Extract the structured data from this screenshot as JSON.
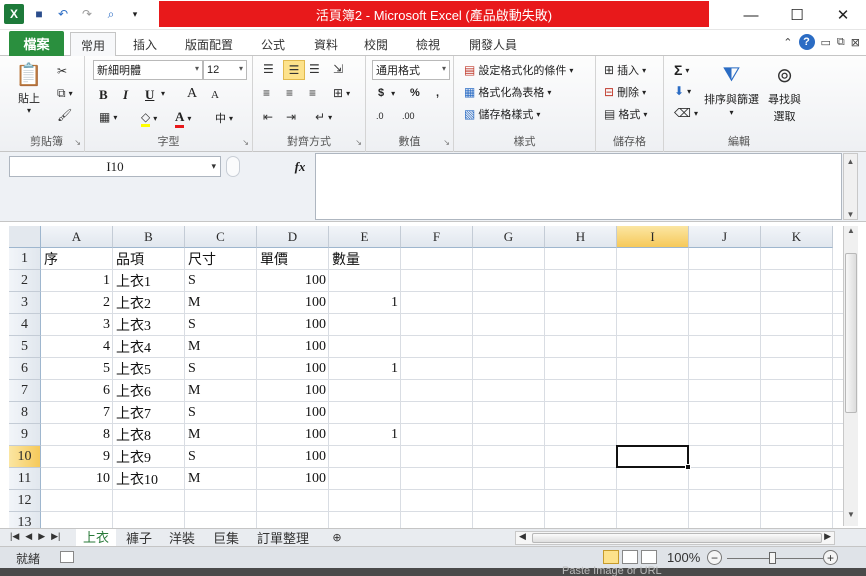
{
  "window": {
    "title": "活頁簿2 - Microsoft Excel (產品啟動失敗)",
    "minimize": "—",
    "maximize": "☐",
    "close": "✕"
  },
  "qat": {
    "logo": "X",
    "save_icon": "💾",
    "undo_icon": "↶",
    "redo_icon": "↷",
    "preview_icon": "🔍"
  },
  "tabs": [
    {
      "label": "檔案"
    },
    {
      "label": "常用"
    },
    {
      "label": "插入"
    },
    {
      "label": "版面配置"
    },
    {
      "label": "公式"
    },
    {
      "label": "資料"
    },
    {
      "label": "校閱"
    },
    {
      "label": "檢視"
    },
    {
      "label": "開發人員"
    }
  ],
  "help_label": "?",
  "ribbon": {
    "clipboard": {
      "label": "剪貼簿",
      "paste": "貼上"
    },
    "font": {
      "label": "字型",
      "font_name": "新細明體",
      "font_size": "12",
      "bold": "B",
      "italic": "I",
      "underline": "U",
      "grow": "A",
      "shrink": "A",
      "font_color_glyph": "A",
      "phonetic": "中"
    },
    "alignment": {
      "label": "對齊方式"
    },
    "number": {
      "label": "數值",
      "format": "通用格式",
      "currency": "$",
      "percent": "%",
      "comma": ",",
      "inc_decimal": ".0",
      "dec_decimal": ".00"
    },
    "styles": {
      "label": "樣式",
      "conditional": "設定格式化的條件",
      "as_table": "格式化為表格",
      "cell_styles": "儲存格樣式"
    },
    "cells": {
      "label": "儲存格",
      "insert": "插入",
      "delete": "刪除",
      "format": "格式"
    },
    "editing": {
      "label": "編輯",
      "sum": "Σ",
      "sort_filter": "排序與篩選",
      "find_select_1": "尋找與",
      "find_select_2": "選取"
    }
  },
  "formula_bar": {
    "name_box": "I10",
    "fx": "fx",
    "formula": ""
  },
  "columns": [
    "A",
    "B",
    "C",
    "D",
    "E",
    "F",
    "G",
    "H",
    "I",
    "J",
    "K"
  ],
  "active_column": "I",
  "row_numbers": [
    "1",
    "2",
    "3",
    "4",
    "5",
    "6",
    "7",
    "8",
    "9",
    "10",
    "11",
    "12",
    "13"
  ],
  "active_row": "10",
  "headers": {
    "A": "序",
    "B": "品項",
    "C": "尺寸",
    "D": "單價",
    "E": "數量"
  },
  "rows": [
    {
      "A": "1",
      "B": "上衣1",
      "C": "S",
      "D": "100",
      "E": ""
    },
    {
      "A": "2",
      "B": "上衣2",
      "C": "M",
      "D": "100",
      "E": "1"
    },
    {
      "A": "3",
      "B": "上衣3",
      "C": "S",
      "D": "100",
      "E": ""
    },
    {
      "A": "4",
      "B": "上衣4",
      "C": "M",
      "D": "100",
      "E": ""
    },
    {
      "A": "5",
      "B": "上衣5",
      "C": "S",
      "D": "100",
      "E": "1"
    },
    {
      "A": "6",
      "B": "上衣6",
      "C": "M",
      "D": "100",
      "E": ""
    },
    {
      "A": "7",
      "B": "上衣7",
      "C": "S",
      "D": "100",
      "E": ""
    },
    {
      "A": "8",
      "B": "上衣8",
      "C": "M",
      "D": "100",
      "E": "1"
    },
    {
      "A": "9",
      "B": "上衣9",
      "C": "S",
      "D": "100",
      "E": ""
    },
    {
      "A": "10",
      "B": "上衣10",
      "C": "M",
      "D": "100",
      "E": ""
    }
  ],
  "sheets": [
    {
      "label": "上衣",
      "active": true
    },
    {
      "label": "褲子",
      "active": false
    },
    {
      "label": "洋裝",
      "active": false
    },
    {
      "label": "巨集",
      "active": false
    },
    {
      "label": "訂單整理",
      "active": false
    }
  ],
  "status": {
    "ready": "就緒",
    "zoom": "100%",
    "zoom_minus": "−",
    "zoom_plus": "+"
  },
  "overlay_text": "Paste Image or URL",
  "colors": {
    "title_red": "#e8191b",
    "file_tab_green": "#2a8f3e",
    "active_header": "#f6c95a"
  }
}
